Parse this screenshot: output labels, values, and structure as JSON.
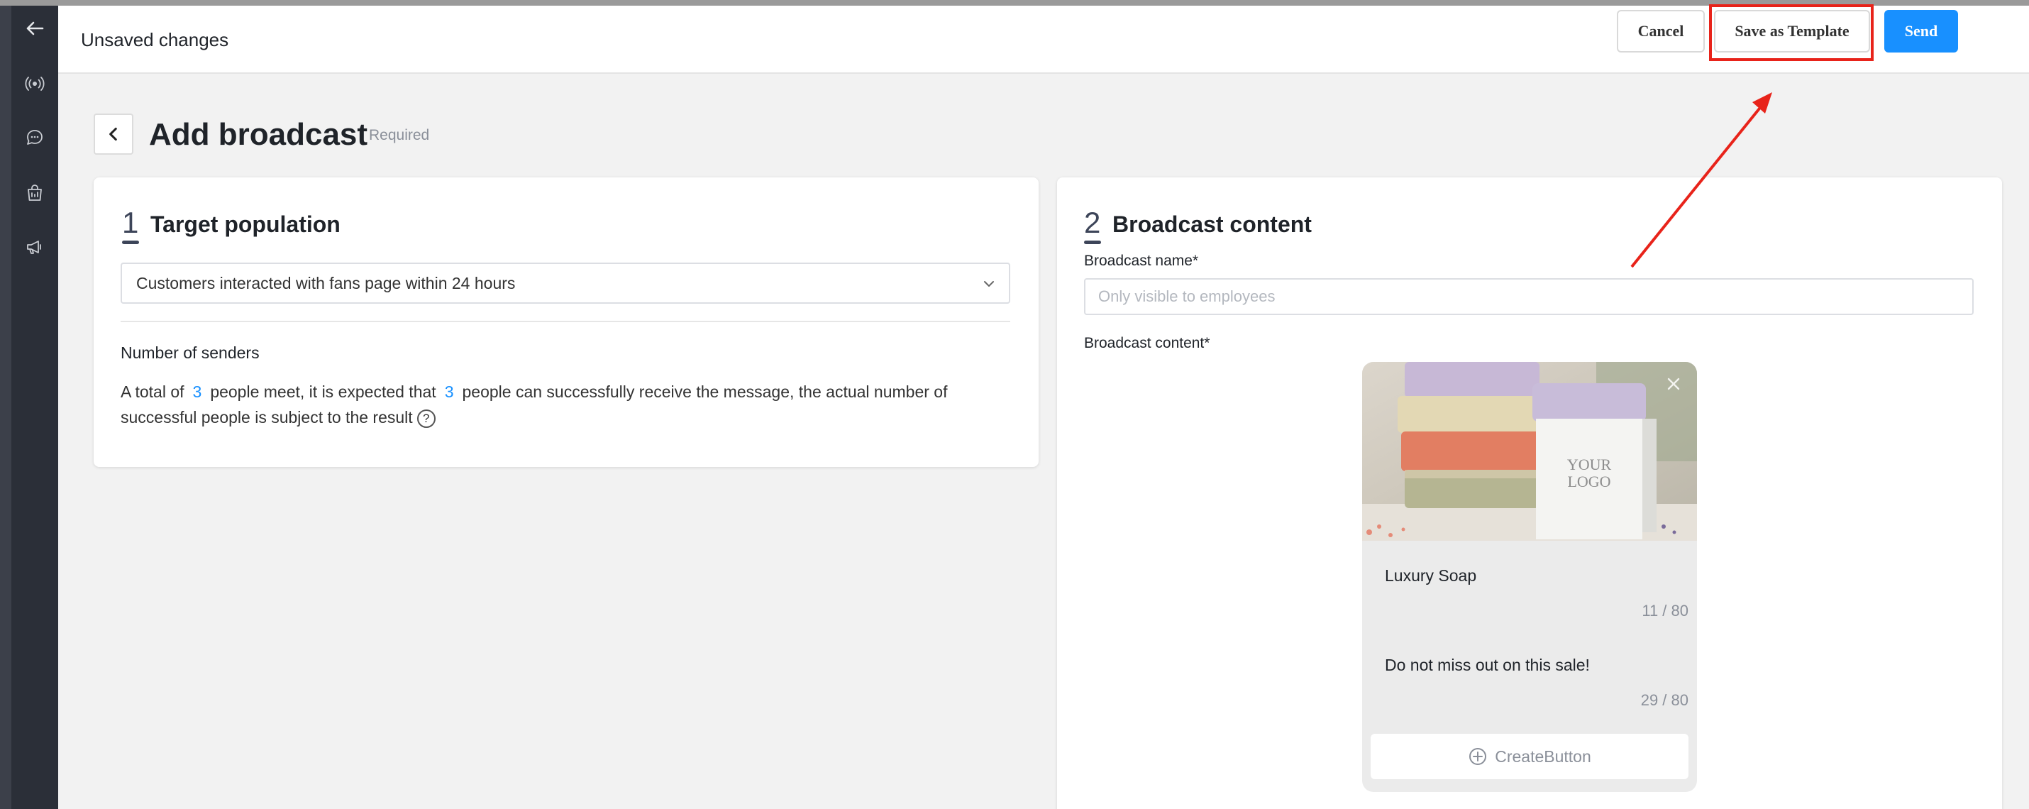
{
  "header": {
    "title": "Unsaved changes",
    "cancel_label": "Cancel",
    "save_template_label": "Save as Template",
    "send_label": "Send"
  },
  "sidebar": {
    "icons": [
      "back-arrow-icon",
      "broadcast-icon",
      "chat-icon",
      "bag-icon",
      "megaphone-icon"
    ]
  },
  "page": {
    "title": "Add broadcast",
    "required_label": "Required"
  },
  "target": {
    "number": "1",
    "title": "Target population",
    "select_value": "Customers interacted with fans page within 24 hours",
    "senders_title": "Number of senders",
    "text_a": "A total of",
    "count_total": "3",
    "text_b": "people meet, it is expected that",
    "count_expected": "3",
    "text_c": "people can successfully receive the message, the actual number of successful people is subject to the result"
  },
  "content": {
    "number": "2",
    "title": "Broadcast content",
    "name_label": "Broadcast name*",
    "name_placeholder": "Only visible to employees",
    "content_label": "Broadcast content*",
    "message": {
      "title": "Luxury Soap",
      "title_count": "11 / 80",
      "subtitle": "Do not miss out on this sale!",
      "subtitle_count": "29 / 80",
      "create_button_label": "CreateButton",
      "image_text_line1": "YOUR",
      "image_text_line2": "LOGO"
    }
  },
  "colors": {
    "primary": "#1890ff",
    "highlight": "#e8231a",
    "sidebar": "#2b2f38"
  }
}
